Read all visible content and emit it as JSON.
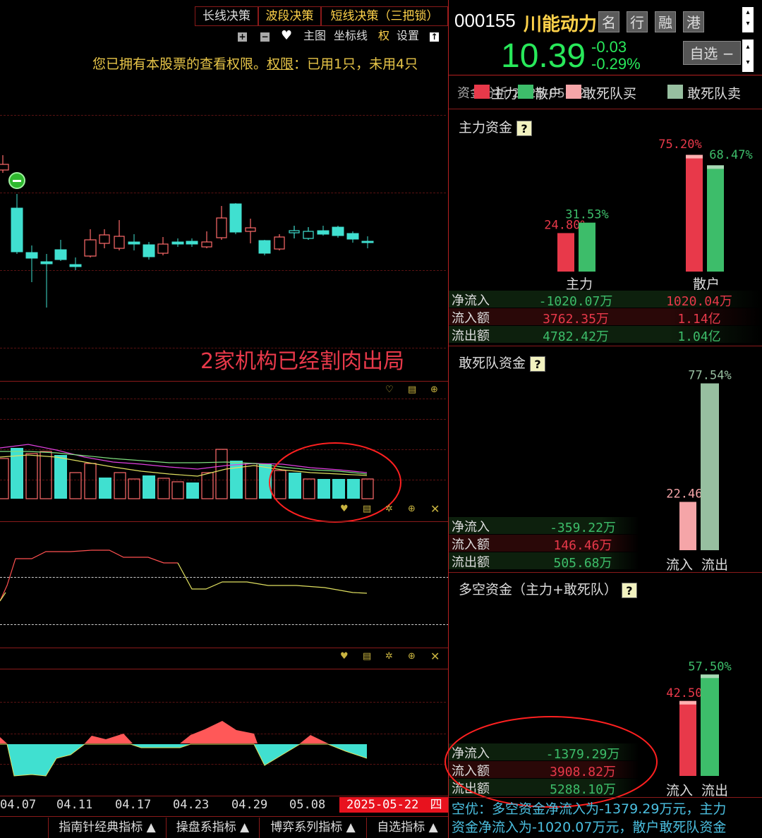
{
  "tabs": [
    "长线决策",
    "波段决策",
    "短线决策（三把锁）"
  ],
  "toolbar": {
    "plus": "+",
    "minus": "−",
    "heart": "♥",
    "main_chart": "主图",
    "axis": "坐标线",
    "right": "权",
    "settings": "设置",
    "up": "↑"
  },
  "notice": {
    "prefix": "您已拥有本股票的查看权限。",
    "link": "权限",
    "suffix": "：已用1只，未用4只"
  },
  "annotation": "2家机构已经割肉出局",
  "dates": [
    "04.07",
    "04.11",
    "04.17",
    "04.23",
    "04.29",
    "05.08"
  ],
  "current_date": "2025-05-22",
  "current_weekday": "四",
  "bottom_tabs": [
    "指南针经典指标 ▲",
    "操盘系指标 ▲",
    "博弈系列指标 ▲",
    "自选指标 ▲"
  ],
  "stock": {
    "code": "000155",
    "name": "川能动力",
    "tags": [
      "名",
      "行",
      "融",
      "港"
    ],
    "price": "10.39",
    "change": "-0.03",
    "change_pct": "-0.29%",
    "watch_label": "自选 −"
  },
  "legend": {
    "overlay_text": "资金分析 2025-05-22",
    "items": [
      {
        "label": "主力",
        "color": "#e8394a"
      },
      {
        "label": "散户",
        "color": "#3dbd6a"
      },
      {
        "label": "敢死队买",
        "color": "#f5a5a8"
      },
      {
        "label": "敢死队卖",
        "color": "#97bfa0"
      }
    ]
  },
  "main_funds": {
    "title": "主力资金",
    "qmark": "?",
    "groups": [
      {
        "label": "主力",
        "in_pct": "24.80%",
        "out_pct": "31.53%",
        "in_val": 24.8,
        "out_val": 31.53
      },
      {
        "label": "散户",
        "in_pct": "75.20%",
        "out_pct": "68.47%",
        "in_val": 75.2,
        "out_val": 68.47
      }
    ],
    "rows": [
      {
        "label": "净流入",
        "v1": "-1020.07万",
        "v2": "1020.04万"
      },
      {
        "label": "流入额",
        "v1": "3762.35万",
        "v2": "1.14亿"
      },
      {
        "label": "流出额",
        "v1": "4782.42万",
        "v2": "1.04亿"
      }
    ]
  },
  "dare_funds": {
    "title": "敢死队资金",
    "qmark": "?",
    "in_pct": "22.46%",
    "out_pct": "77.54%",
    "in_val": 22.46,
    "out_val": 77.54,
    "in_label": "流入",
    "out_label": "流出",
    "rows": [
      {
        "label": "净流入",
        "v": "-359.22万"
      },
      {
        "label": "流入额",
        "v": "146.46万"
      },
      {
        "label": "流出额",
        "v": "505.68万"
      }
    ]
  },
  "long_short": {
    "title": "多空资金（主力+敢死队）",
    "qmark": "?",
    "in_pct": "42.50%",
    "out_pct": "57.50%",
    "in_val": 42.5,
    "out_val": 57.5,
    "in_label": "流入",
    "out_label": "流出",
    "rows": [
      {
        "label": "净流入",
        "v": "-1379.29万"
      },
      {
        "label": "流入额",
        "v": "3908.82万"
      },
      {
        "label": "流出额",
        "v": "5288.10万"
      }
    ]
  },
  "summary": {
    "line1": "空优：多空资金净流入为-1379.29万元，主力",
    "line2": "资金净流入为-1020.07万元，散户敢死队资金"
  },
  "colors": {
    "red": "#e8394a",
    "green": "#3dbd6a",
    "cyan": "#40e0d0",
    "yellow": "#f2e000",
    "gold": "#ffd24a",
    "pink": "#f5a5a8",
    "sage": "#97bfa0"
  }
}
